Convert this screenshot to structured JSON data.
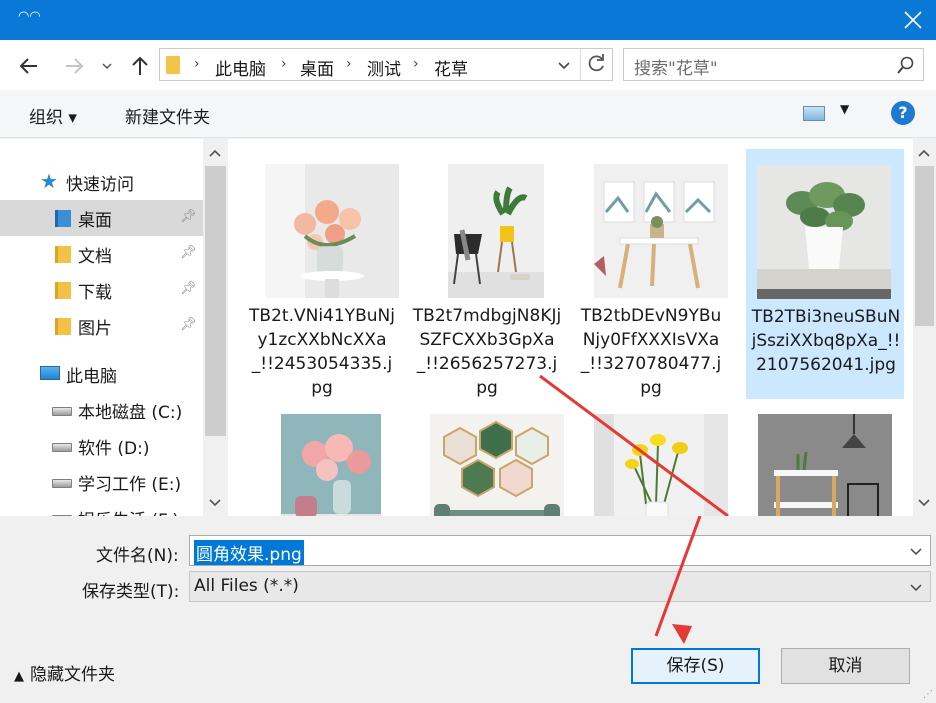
{
  "address": {
    "crumbs": [
      "此电脑",
      "桌面",
      "测试",
      "花草"
    ]
  },
  "search": {
    "placeholder": "搜索\"花草\""
  },
  "toolbar": {
    "organize": "组织 ▾",
    "new_folder": "新建文件夹",
    "help": "?"
  },
  "nav": {
    "quick_access": "快速访问",
    "quick_items": [
      "桌面",
      "文档",
      "下载",
      "图片"
    ],
    "this_pc": "此电脑",
    "drives": [
      "本地磁盘 (C:)",
      "软件 (D:)",
      "学习工作 (E:)",
      "娱乐生活 (F:)"
    ]
  },
  "files": [
    {
      "name": "TB2t.VNi41YBuNjy1zcXXbNcXXa_!!2453054335.jpg",
      "icon": "photo-roses-icon"
    },
    {
      "name": "TB2t7mdbgjN8KJjSZFCXXb3GpXa_!!2656257273.jpg",
      "icon": "photo-chair-plant-icon"
    },
    {
      "name": "TB2tbDEvN9YBuNjy0FfXXXIsVXa_!!3270780477.jpg",
      "icon": "photo-table-art-icon"
    },
    {
      "name": "TB2TBi3neuSBuNjSsziXXbq8pXa_!!2107562041.jpg",
      "icon": "photo-potted-plant-icon"
    },
    {
      "name": "",
      "icon": "photo-pink-flowers-icon"
    },
    {
      "name": "",
      "icon": "photo-hexagon-art-icon"
    },
    {
      "name": "",
      "icon": "photo-yellow-flowers-icon"
    },
    {
      "name": "",
      "icon": "photo-side-table-icon"
    }
  ],
  "form": {
    "filename_label": "文件名(N):",
    "filename_value": "圆角效果.png",
    "type_label": "保存类型(T):",
    "type_value": "All Files (*.*)"
  },
  "buttons": {
    "save": "保存(S)",
    "cancel": "取消",
    "hide_folders": "隐藏文件夹"
  },
  "colors": {
    "titlebar": "#0a78d7",
    "selection": "#cce8ff",
    "accent": "#0078d7",
    "arrow": "#e53935"
  }
}
